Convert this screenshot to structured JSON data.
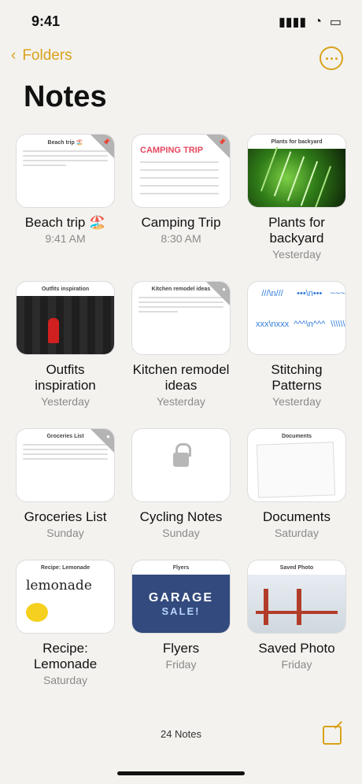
{
  "status": {
    "time": "9:41"
  },
  "nav": {
    "back_label": "Folders"
  },
  "page": {
    "title": "Notes"
  },
  "notes": [
    {
      "title": "Beach trip 🏖️",
      "subtitle": "9:41 AM"
    },
    {
      "title": "Camping Trip",
      "subtitle": "8:30 AM"
    },
    {
      "title": "Plants for backyard",
      "subtitle": "Yesterday"
    },
    {
      "title": "Outfits inspiration",
      "subtitle": "Yesterday"
    },
    {
      "title": "Kitchen remodel ideas",
      "subtitle": "Yesterday"
    },
    {
      "title": "Stitching Patterns",
      "subtitle": "Yesterday"
    },
    {
      "title": "Groceries List",
      "subtitle": "Sunday"
    },
    {
      "title": "Cycling Notes",
      "subtitle": "Sunday"
    },
    {
      "title": "Documents",
      "subtitle": "Saturday"
    },
    {
      "title": "Recipe: Lemonade",
      "subtitle": "Saturday"
    },
    {
      "title": "Flyers",
      "subtitle": "Friday"
    },
    {
      "title": "Saved Photo",
      "subtitle": "Friday"
    }
  ],
  "thumbs": {
    "beach": {
      "header": "Beach trip 🏖️"
    },
    "camping": {
      "text": "CAMPING TRIP"
    },
    "plants": {
      "header": "Plants for backyard"
    },
    "outfits": {
      "header": "Outfits inspiration"
    },
    "kitchen": {
      "header": "Kitchen remodel ideas"
    },
    "groceries": {
      "header": "Groceries List"
    },
    "documents": {
      "header": "Documents"
    },
    "lemonade": {
      "header": "Recipe: Lemonade",
      "script": "lemonade"
    },
    "flyers": {
      "header": "Flyers",
      "line1": "GARAGE",
      "line2": "SALE!"
    },
    "saved": {
      "header": "Saved Photo"
    }
  },
  "footer": {
    "count": "24 Notes"
  }
}
